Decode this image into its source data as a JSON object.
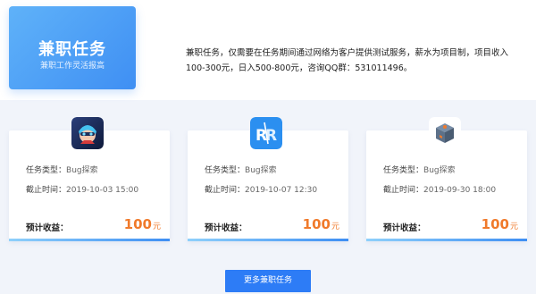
{
  "hero": {
    "title": "兼职任务",
    "subtitle": "兼职工作灵活报高",
    "description": "兼职任务，仅需要在任务期间通过网络为客户提供测试服务，薪水为项目制，项目收入100-300元，日入500-800元，咨询QQ群：531011496。"
  },
  "tasks": [
    {
      "icon": "game-character-icon",
      "type_label": "任务类型：",
      "type_value": "Bug探索",
      "deadline_label": "截止时间：",
      "deadline_value": "2019-10-03 15:00",
      "earn_label": "预计收益：",
      "earn_amount": "100",
      "earn_unit": "元"
    },
    {
      "icon": "rr-app-icon",
      "type_label": "任务类型：",
      "type_value": "Bug探索",
      "deadline_label": "截止时间：",
      "deadline_value": "2019-10-07 12:30",
      "earn_label": "预计收益：",
      "earn_amount": "100",
      "earn_unit": "元"
    },
    {
      "icon": "box-app-icon",
      "type_label": "任务类型：",
      "type_value": "Bug探索",
      "deadline_label": "截止时间：",
      "deadline_value": "2019-09-30 18:00",
      "earn_label": "预计收益：",
      "earn_amount": "100",
      "earn_unit": "元"
    }
  ],
  "more_button": "更多兼职任务",
  "colors": {
    "accent": "#2d7cf6",
    "earn": "#f07a2b",
    "hero_gradient_start": "#5fb2f9",
    "hero_gradient_end": "#3f8ff3"
  }
}
